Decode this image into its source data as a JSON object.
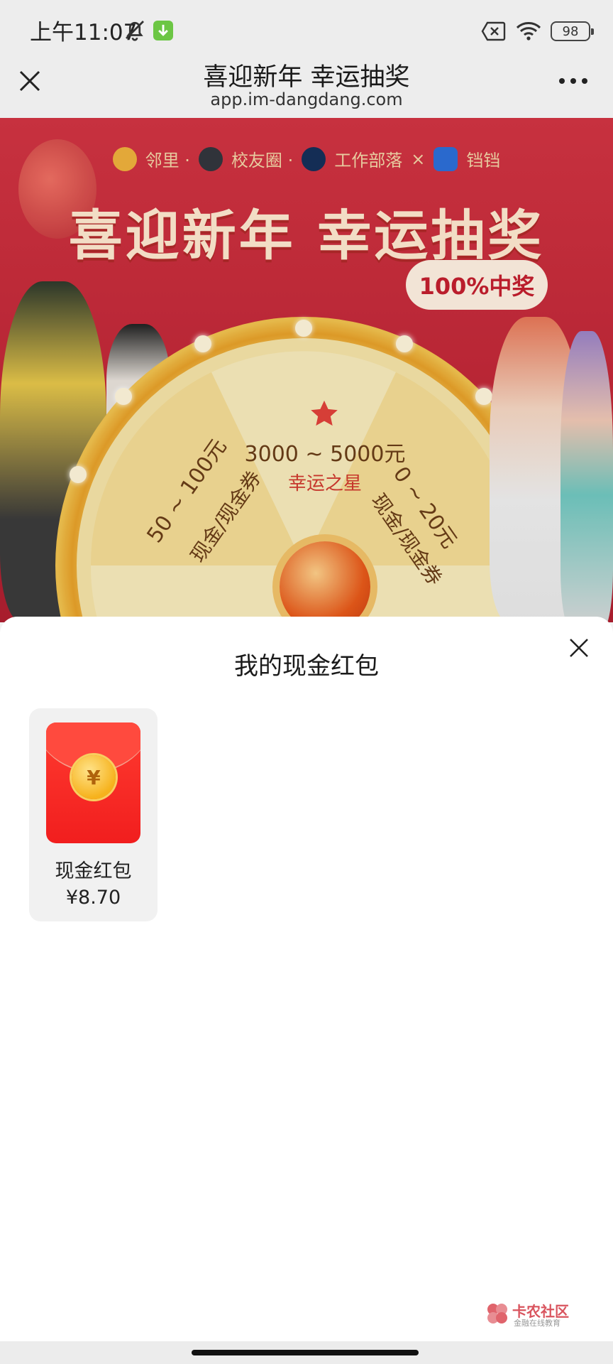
{
  "status_bar": {
    "time": "上午11:07",
    "battery": "98",
    "icons": [
      "bell-off-icon",
      "download-icon",
      "no-sim-icon",
      "wifi-icon",
      "battery-icon"
    ]
  },
  "nav": {
    "title": "喜迎新年 幸运抽奖",
    "subtitle": "app.im-dangdang.com",
    "icons": [
      "close-icon",
      "more-icon"
    ]
  },
  "banner": {
    "brands": [
      "邻里 ·",
      "校友圈 ·",
      "工作部落",
      "×",
      "铛铛"
    ],
    "title": "喜迎新年 幸运抽奖",
    "badge": "100%中奖",
    "wheel": {
      "top_prize": "3000 ~ 5000元",
      "top_label": "幸运之星",
      "left_prize": "50 ~ 100元",
      "left_label": "现金/现金券",
      "right_prize": "0 ~ 20元",
      "right_label": "现金/现金券"
    }
  },
  "sheet": {
    "title": "我的现金红包",
    "items": [
      {
        "name": "现金红包",
        "amount": "¥8.70",
        "coin_symbol": "¥"
      }
    ]
  },
  "watermark": {
    "title": "卡农社区",
    "subtitle": "金融在线教育"
  },
  "colors": {
    "red_envelope": "#f11e1e",
    "banner_red": "#c02736",
    "coin_gold": "#f6b21c"
  }
}
